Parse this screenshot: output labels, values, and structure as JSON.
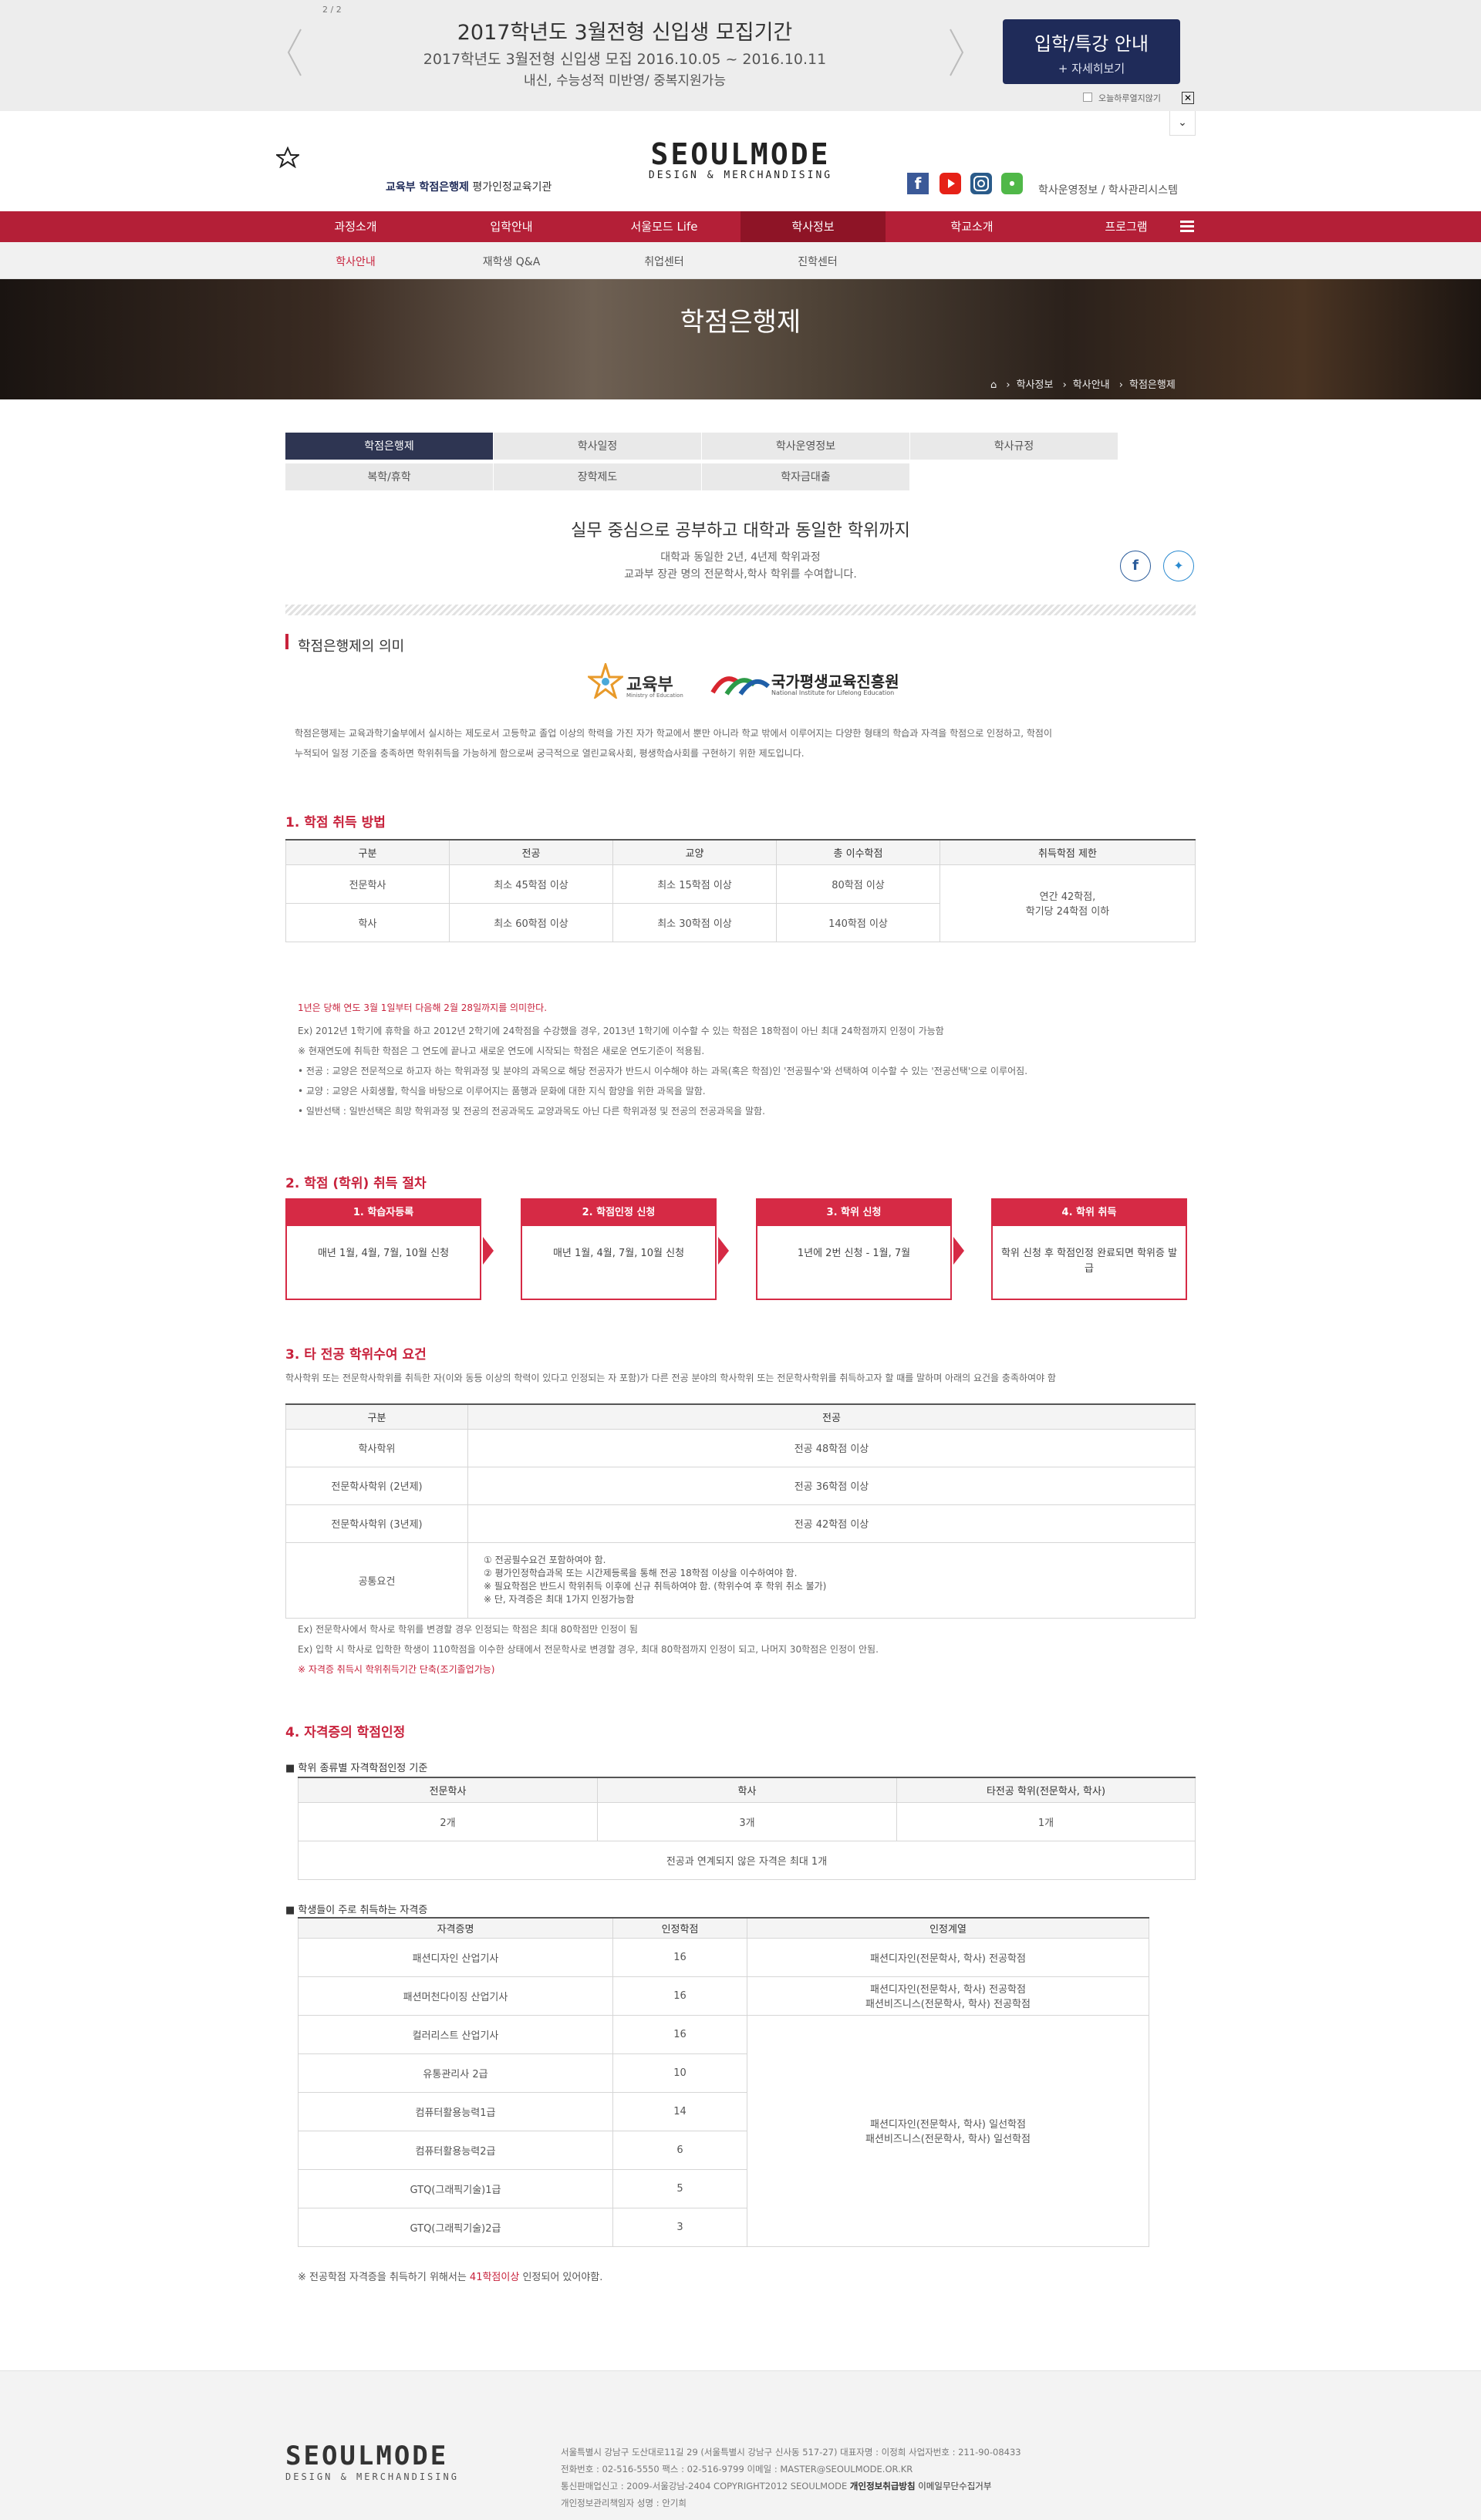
{
  "promo": {
    "counter": "2 / 2",
    "title": "2017학년도 3월전형 신입생 모집기간",
    "line1": "2017학년도 3월전형 신입생 모집 2016.10.05 ~ 2016.10.11",
    "line2": "내신, 수능성적 미반영/ 중복지원가능",
    "btn_title": "입학/특강 안내",
    "btn_sub": "+ 자세히보기",
    "today_close": "오늘하루열지않기"
  },
  "header": {
    "ministry_link": "교육부 학점은행제",
    "ministry_text": " 평가인정교육기관",
    "logo_main": "SEOULMODE",
    "logo_sub": "DESIGN & MERCHANDISING",
    "util1": "학사운영정보",
    "util_sep": "/",
    "util2": "학사관리시스템"
  },
  "gnb": [
    "과정소개",
    "입학안내",
    "서울모드 Life",
    "학사정보",
    "학교소개",
    "프로그램"
  ],
  "lnb": [
    "학사안내",
    "재학생 Q&A",
    "취업센터",
    "진학센터"
  ],
  "visual": {
    "title": "학점은행제",
    "crumb1": "학사정보",
    "crumb2": "학사안내",
    "crumb3": "학점은행제"
  },
  "tabs": [
    "학점은행제",
    "학사일정",
    "학사운영정보",
    "학사규정",
    "복학/휴학",
    "장학제도",
    "학자금대출"
  ],
  "intro": {
    "title": "실무 중심으로 공부하고 대학과 동일한 학위까지",
    "sub1": "대학과 동일한 2년, 4년제 학위과정",
    "sub2": "교과부 장관 명의 전문학사,학사 학위를 수여합니다."
  },
  "meaning": {
    "title": "학점은행제의 의미",
    "logo1": "교육부",
    "logo1_en": "Ministry of Education",
    "logo2": "국가평생교육진흥원",
    "logo2_en": "National Institute for Lifelong Education",
    "text1": "학점은행제는 교육과학기술부에서 실시하는 제도로서 고등학교 졸업 이상의 학력을 가진 자가 학교에서 뿐만 아니라 학교 밖에서 이루어지는 다양한 형태의 학습과 자격을 학점으로 인정하고, 학점이",
    "text2": "누적되어 일정 기준을 충족하면 학위취득을 가능하게 함으로써 궁극적으로 열린교육사회, 평생학습사회를 구현하기 위한 제도입니다."
  },
  "sec1": {
    "title": "1. 학점 취득 방법",
    "headers": [
      "구분",
      "전공",
      "교양",
      "총 이수학점",
      "취득학점 제한"
    ],
    "rows": [
      [
        "전문학사",
        "최소 45학점 이상",
        "최소 15학점 이상",
        "80학점 이상"
      ],
      [
        "학사",
        "최소 60학점 이상",
        "최소 30학점 이상",
        "140학점 이상"
      ]
    ],
    "limit1": "연간 42학점,",
    "limit2": "학기당 24학점 이하",
    "note_red": "1년은 당해 연도 3월 1일부터 다음해 2월 28일까지를 의미한다.",
    "notes": [
      "Ex) 2012년 1학기에 휴학을 하고 2012년 2학기에 24학점을 수강했을 경우, 2013년 1학기에 이수할 수 있는 학점은 18학점이 아닌 최대 24학점까지 인정이 가능함",
      "※ 현재연도에 취득한 학점은 그 연도에 끝나고 새로운 연도에 시작되는 학점은 새로운 연도기준이 적용됨.",
      "• 전공 : 교양은 전문적으로 하고자 하는 학위과정 및 분야의 과목으로 해당 전공자가 반드시 이수해야 하는 과목(혹은 학점)인 '전공필수'와 선택하여 이수할 수 있는 '전공선택'으로 이루어짐.",
      "• 교양 : 교양은 사회생활, 학식을 바탕으로 이루어지는 품행과 문화에 대한 지식 함양을 위한 과목을 말함.",
      "• 일반선택 : 일반선택은 희망 학위과정 및 전공의 전공과목도 교양과목도 아닌 다른 학위과정 및 전공의 전공과목을 말함."
    ]
  },
  "sec2": {
    "title": "2. 학점 (학위) 취득 절차",
    "steps": [
      {
        "h": "1. 학습자등록",
        "b": "매년 1월, 4월, 7월, 10월 신청"
      },
      {
        "h": "2. 학점인정 신청",
        "b": "매년 1월, 4월, 7월, 10월 신청"
      },
      {
        "h": "3. 학위 신청",
        "b": "1년에 2번 신청 - 1월, 7월"
      },
      {
        "h": "4. 학위 취득",
        "b": "학위 신청 후 학점인정 완료되면 학위증 발급"
      }
    ]
  },
  "sec3": {
    "title": "3. 타 전공 학위수여 요건",
    "desc": "학사학위 또는 전문학사학위를 취득한 자(이와 동등 이상의 학력이 있다고 인정되는 자 포함)가 다른 전공 분야의 학사학위 또는 전문학사학위를 취득하고자 할 때를 말하며 아래의 요건을 충족하여야 함",
    "headers": [
      "구분",
      "전공"
    ],
    "rows": [
      [
        "학사학위",
        "전공 48학점 이상"
      ],
      [
        "전문학사학위 (2년제)",
        "전공 36학점 이상"
      ],
      [
        "전문학사학위 (3년제)",
        "전공 42학점 이상"
      ]
    ],
    "common_label": "공통요건",
    "common": [
      "① 전공필수요건 포함하여야 함.",
      "② 평가인정학습과목 또는 시간제등록을 통해 전공 18학점 이상을 이수하여야 함.",
      "※ 필요학점은 반드시 학위취득 이후에 신규 취득하여야 함. (학위수여 후 학위 취소 불가)",
      "※ 단, 자격증은 최대 1가지 인정가능함"
    ],
    "notes": [
      "Ex) 전문학사에서 학사로 학위를 변경할 경우 인정되는 학점은 최대 80학점만 인정이 됨",
      "Ex) 입학 시 학사로 입학한 학생이 110학점을 이수한 상태에서 전문학사로 변경할 경우, 최대 80학점까지 인정이 되고, 나머지 30학점은 인정이 안됨."
    ],
    "note_red": "※ 자격증 취득시 학위취득기간 단축(조기졸업가능)"
  },
  "sec4": {
    "title": "4. 자격증의 학점인정",
    "sub1": "학위 종류별 자격학점인정 기준",
    "t1_headers": [
      "전문학사",
      "학사",
      "타전공 학위(전문학사, 학사)"
    ],
    "t1_row": [
      "2개",
      "3개",
      "1개"
    ],
    "t1_note": "전공과 연계되지 않은 자격은 최대 1개",
    "sub2": "학생들이 주로 취득하는 자격증",
    "t2_headers": [
      "자격증명",
      "인정학점",
      "인정계열"
    ],
    "t2_rows": [
      [
        "패션디자인 산업기사",
        "16"
      ],
      [
        "패션머천다이징 산업기사",
        "16"
      ],
      [
        "컬러리스트 산업기사",
        "16"
      ],
      [
        "유통관리사 2급",
        "10"
      ],
      [
        "컴퓨터활용능력1급",
        "14"
      ],
      [
        "컴퓨터활용능력2급",
        "6"
      ],
      [
        "GTQ(그래픽기술)1급",
        "5"
      ],
      [
        "GTQ(그래픽기술)2급",
        "3"
      ]
    ],
    "field1": "패션디자인(전문학사, 학사) 전공학점",
    "field2a": "패션디자인(전문학사, 학사) 전공학점",
    "field2b": "패션비즈니스(전문학사, 학사) 전공학점",
    "field3a": "패션디자인(전문학사, 학사) 일선학점",
    "field3b": "패션비즈니스(전문학사, 학사) 일선학점",
    "foot_a": "※ 전공학점 자격증을 취득하기 위해서는 ",
    "foot_red": "41학점이상",
    "foot_b": " 인정되어 있어야함."
  },
  "footer": {
    "logo_main": "SEOULMODE",
    "logo_sub": "DESIGN & MERCHANDISING",
    "l1": "서울특별시 강남구 도산대로11길 29 (서울특별시 강남구 신사동 517-27)    대표자명 : 이정희    사업자번호 : 211-90-08433",
    "l2": "전화번호 : 02-516-5550    팩스 : 02-516-9799    이메일 : MASTER@SEOULMODE.OR.KR",
    "l3a": "통신판매업신고 : 2009-서울강남-2404    COPYRIGHT2012 SEOULMODE    ",
    "l3b": "개인정보취급방침",
    "l3c": "  이메일무단수집거부",
    "l4": "개인정보관리책임자 성명 : 안기희"
  }
}
